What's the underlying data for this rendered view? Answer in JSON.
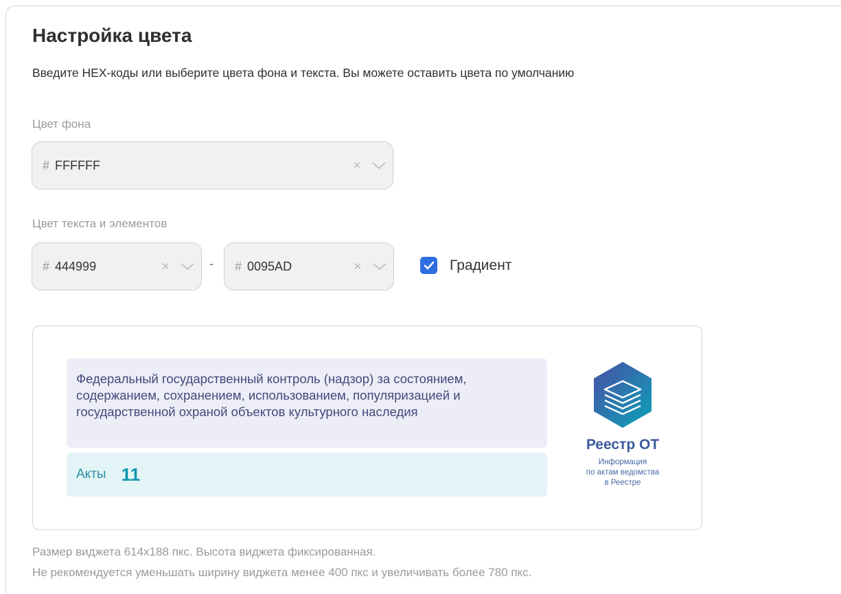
{
  "header": {
    "title": "Настройка цвета",
    "subtitle": "Введите HEX-коды или выберите цвета фона и текста. Вы можете оставить цвета по умолчанию"
  },
  "background_color": {
    "label": "Цвет фона",
    "prefix": "#",
    "value": "FFFFFF"
  },
  "text_color": {
    "label": "Цвет текста и элементов",
    "from": {
      "prefix": "#",
      "value": "444999"
    },
    "separator": "-",
    "to": {
      "prefix": "#",
      "value": "0095AD"
    },
    "gradient_label": "Градиент",
    "gradient_checked": true
  },
  "preview": {
    "description": "Федеральный государственный контроль (надзор) за состоянием, содержанием, сохранением, использованием, популяризацией и государственной охраной объектов культурного наследия",
    "acts_label": "Акты",
    "acts_count": "11",
    "logo_title": "Реестр ОТ",
    "logo_sub1": "Информация",
    "logo_sub2": "по актам ведомства",
    "logo_sub3": "в Реестре"
  },
  "notes": {
    "line1": "Размер виджета 614х188 пкс. Высота виджета фиксированная.",
    "line2": "Не рекомендуется уменьшать ширину виджета менее 400 пкс и увеличивать более 780 пкс."
  },
  "colors": {
    "checkbox": "#2f6de1",
    "gradient_start": "#444999",
    "gradient_end": "#0095AD"
  },
  "icons": {
    "clear": "close-icon",
    "dropdown": "chevron-down-icon",
    "checkbox": "check-icon",
    "logo": "layers-hexagon-icon"
  }
}
